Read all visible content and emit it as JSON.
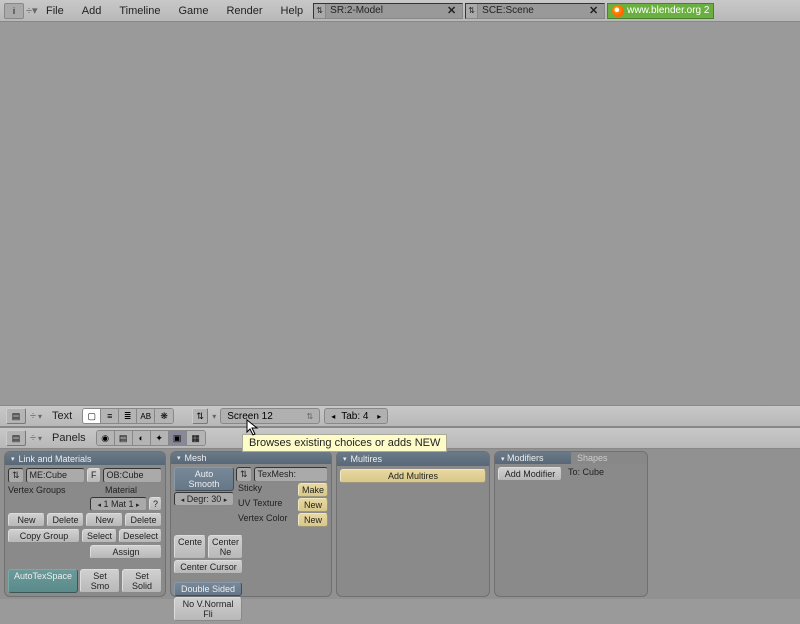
{
  "top": {
    "menu": [
      "File",
      "Add",
      "Timeline",
      "Game",
      "Render",
      "Help"
    ],
    "layout_field": "SR:2-Model",
    "scene_field": "SCE:Scene",
    "link_text": "www.blender.org 2"
  },
  "text_header": {
    "label": "Text",
    "screen_field": "Screen 12",
    "tab_field": "Tab: 4"
  },
  "buttons_header": {
    "label": "Panels"
  },
  "tooltip": "Browses existing choices or adds NEW",
  "panels": {
    "link_materials": {
      "title": "Link and Materials",
      "me_field": "ME:Cube",
      "f_btn": "F",
      "ob_field": "OB:Cube",
      "vertex_groups": "Vertex Groups",
      "material": "Material",
      "mat_field": "1 Mat 1",
      "q_btn": "?",
      "new": "New",
      "delete": "Delete",
      "select": "Select",
      "deselect": "Deselect",
      "copy_group": "Copy Group",
      "assign": "Assign",
      "autotex": "AutoTexSpace",
      "set_smooth": "Set Smo",
      "set_solid": "Set Solid"
    },
    "mesh": {
      "title": "Mesh",
      "auto_smooth": "Auto Smooth",
      "degr": "Degr: 30",
      "texmesh": "TexMesh:",
      "sticky": "Sticky",
      "make": "Make",
      "uv_texture": "UV Texture",
      "vertex_color": "Vertex Color",
      "new": "New",
      "center": "Cente",
      "center_new": "Center Ne",
      "center_cursor": "Center Cursor",
      "double_sided": "Double Sided",
      "no_vnormal": "No V.Normal Fli"
    },
    "multires": {
      "title": "Multires",
      "add": "Add Multires"
    },
    "modifiers": {
      "tab_active": "Modifiers",
      "tab_inactive": "Shapes",
      "add_modifier": "Add Modifier",
      "to_label": "To: Cube"
    }
  }
}
